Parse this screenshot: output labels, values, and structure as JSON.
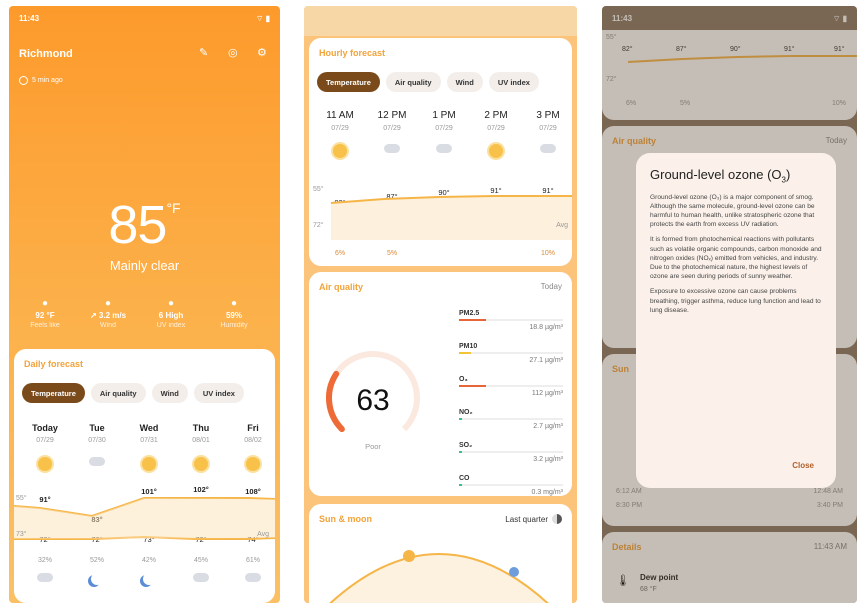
{
  "panel1": {
    "status_time": "11:43",
    "city": "Richmond",
    "updated": "5 min ago",
    "temp": "85",
    "unit": "°F",
    "condition": "Mainly clear",
    "stats": [
      {
        "value": "92 °F",
        "label": "Feels like",
        "icon": "thermometer-icon"
      },
      {
        "value": "↗ 3.2 m/s",
        "label": "Wind",
        "icon": "fan-icon"
      },
      {
        "value": "6 High",
        "label": "UV index",
        "icon": "sun-icon"
      },
      {
        "value": "59%",
        "label": "Humidity",
        "icon": "droplet-icon"
      }
    ],
    "daily": {
      "title": "Daily forecast",
      "tabs": [
        "Temperature",
        "Air quality",
        "Wind",
        "UV index"
      ],
      "days": [
        {
          "day": "Today",
          "date": "07/29",
          "hi": "91°",
          "lo": "72°",
          "pct": "32%",
          "day_icon": "sun",
          "night_icon": "cloud"
        },
        {
          "day": "Tue",
          "date": "07/30",
          "hi": "83°",
          "lo": "72°",
          "pct": "52%",
          "day_icon": "cloud",
          "night_icon": "moon"
        },
        {
          "day": "Wed",
          "date": "07/31",
          "hi": "101°",
          "lo": "73°",
          "pct": "42%",
          "day_icon": "sun",
          "night_icon": "moon"
        },
        {
          "day": "Thu",
          "date": "08/01",
          "hi": "102°",
          "lo": "72°",
          "pct": "45%",
          "day_icon": "sun",
          "night_icon": "cloud"
        },
        {
          "day": "Fri",
          "date": "08/02",
          "hi": "108°",
          "lo": "74°",
          "pct": "61%",
          "day_icon": "sun",
          "night_icon": "cloud"
        }
      ],
      "axis_hi": "55°",
      "axis_lo": "73°",
      "avg_label": "Avg"
    }
  },
  "panel2": {
    "hourly": {
      "title": "Hourly forecast",
      "tabs": [
        "Temperature",
        "Air quality",
        "Wind",
        "UV index"
      ],
      "hours": [
        {
          "time": "11 AM",
          "date": "07/29",
          "temp": "82°",
          "pct": "6%",
          "icon": "sun"
        },
        {
          "time": "12 PM",
          "date": "07/29",
          "temp": "87°",
          "pct": "5%",
          "icon": "cloud"
        },
        {
          "time": "1 PM",
          "date": "07/29",
          "temp": "90°",
          "pct": "",
          "icon": "cloud"
        },
        {
          "time": "2 PM",
          "date": "07/29",
          "temp": "91°",
          "pct": "",
          "icon": "sun"
        },
        {
          "time": "3 PM",
          "date": "07/29",
          "temp": "91°",
          "pct": "10%",
          "icon": "cloud"
        }
      ],
      "axis_hi": "55°",
      "axis_lo": "72°",
      "avg_label": "Avg"
    },
    "air": {
      "title": "Air quality",
      "when": "Today",
      "aqi": "63",
      "aqi_label": "Poor",
      "pollutants": [
        {
          "name": "PM2.5",
          "value": "18.8 µg/m³",
          "color": "#e8653a",
          "level": 0.26
        },
        {
          "name": "PM10",
          "value": "27.1 µg/m³",
          "color": "#f2c437",
          "level": 0.12
        },
        {
          "name": "O₃",
          "value": "112 µg/m³",
          "color": "#e8653a",
          "level": 0.26
        },
        {
          "name": "NO₂",
          "value": "2.7 µg/m³",
          "color": "#3cc08a",
          "level": 0.03
        },
        {
          "name": "SO₂",
          "value": "3.2 µg/m³",
          "color": "#3cc08a",
          "level": 0.03
        },
        {
          "name": "CO",
          "value": "0.3 mg/m³",
          "color": "#3cc08a",
          "level": 0.03
        }
      ]
    },
    "sunmoon": {
      "title": "Sun & moon",
      "phase": "Last quarter"
    }
  },
  "panel3": {
    "status_time": "11:43",
    "temps": [
      "82°",
      "87°",
      "90°",
      "91°",
      "91°"
    ],
    "pcts": [
      "6%",
      "5%",
      "10%"
    ],
    "axis_hi": "55°",
    "axis_lo": "72°",
    "air_title": "Air quality",
    "air_when": "Today",
    "sun_title": "Sun",
    "times": [
      "6:12 AM",
      "8:30 PM",
      "12:48 AM",
      "3:40 PM"
    ],
    "details_title": "Details",
    "details_time": "11:43 AM",
    "dew_label": "Dew point",
    "dew_value": "68 °F",
    "dialog": {
      "title_main": "Ground-level ozone (O",
      "title_sub": "3",
      "title_end": ")",
      "p1": "Ground-level ozone (O₃) is a major component of smog. Although the same molecule, ground-level ozone can be harmful to human health, unlike stratospheric ozone that protects the earth from excess UV radiation.",
      "p2": "It is formed from photochemical reactions with pollutants such as volatile organic compounds, carbon monoxide and nitrogen oxides (NOₓ) emitted from vehicles, and industry. Due to the photochemical nature, the highest levels of ozone are seen during periods of sunny weather.",
      "p3": "Exposure to excessive ozone can cause problems breathing, trigger asthma, reduce lung function and lead to lung disease.",
      "close": "Close"
    }
  }
}
